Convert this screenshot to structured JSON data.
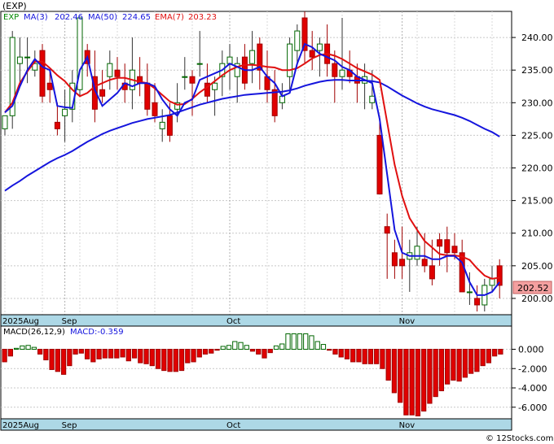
{
  "header": {
    "symbol_label": "(EXP)",
    "legend": {
      "exp": "EXP",
      "ma3_label": "MA(3)",
      "ma3_value": "202.46",
      "ma50_label": "MA(50)",
      "ma50_value": "224.65",
      "ema7_label": "EMA(7)",
      "ema7_value": "203.23"
    }
  },
  "last_price_label": "202.52",
  "macd_legend": {
    "name": "MACD(26,12,9)",
    "value": "MACD:-0.359"
  },
  "month_labels": [
    {
      "text": "2025Aug",
      "index": 0
    },
    {
      "text": "Sep",
      "index": 8
    },
    {
      "text": "Oct",
      "index": 30
    },
    {
      "text": "Nov",
      "index": 53
    }
  ],
  "watermark": "© 12Stocks.com",
  "colors": {
    "up": "#ffffff",
    "down": "#e00000",
    "ma3": "#1515dd",
    "ma50": "#1515dd",
    "ema7": "#e01010",
    "axis_band": "#add8e6",
    "price_tag_bg": "#f4a0a0",
    "macd_pos": "#ffffff",
    "macd_neg": "#e00000"
  },
  "chart_data": {
    "type": "candlestick",
    "price_axis": {
      "ylim": [
        197.5,
        244
      ],
      "ticks": [
        200,
        205,
        210,
        215,
        220,
        225,
        230,
        235,
        240
      ]
    },
    "macd_axis": {
      "ylim": [
        -7.2,
        2.4
      ],
      "ticks": [
        0.0,
        -2.0,
        -4.0,
        -6.0
      ],
      "tick_labels": [
        "0.000",
        "-2.000",
        "-4.000",
        "-6.000"
      ]
    },
    "candles": [
      [
        226,
        228,
        225,
        228
      ],
      [
        228,
        241,
        226,
        240
      ],
      [
        236,
        240,
        233,
        237
      ],
      [
        237,
        240,
        233,
        237
      ],
      [
        235,
        238,
        234,
        236
      ],
      [
        238,
        239,
        230,
        231
      ],
      [
        233,
        235,
        230,
        232
      ],
      [
        227,
        230,
        225,
        226
      ],
      [
        228,
        232,
        224,
        229
      ],
      [
        229,
        235,
        227,
        233
      ],
      [
        232,
        243,
        231,
        243
      ],
      [
        238,
        239,
        234,
        236
      ],
      [
        234,
        238,
        227,
        229
      ],
      [
        232,
        235,
        230,
        231
      ],
      [
        234,
        238,
        232,
        236
      ],
      [
        235,
        237,
        232,
        234
      ],
      [
        233,
        236,
        230,
        232
      ],
      [
        232,
        240,
        229,
        235
      ],
      [
        234,
        237,
        231,
        233
      ],
      [
        233,
        236,
        228,
        229
      ],
      [
        230,
        233,
        227,
        228
      ],
      [
        226,
        229,
        224,
        227
      ],
      [
        228,
        230,
        224,
        225
      ],
      [
        229,
        233,
        227,
        230
      ],
      [
        234,
        237,
        232,
        234
      ],
      [
        234,
        235,
        228,
        233
      ],
      [
        236,
        241,
        234,
        236
      ],
      [
        233,
        236,
        230,
        231
      ],
      [
        232,
        234,
        228,
        233
      ],
      [
        234,
        238,
        231,
        236
      ],
      [
        236,
        239,
        232,
        237
      ],
      [
        234,
        237,
        230,
        236
      ],
      [
        237,
        239,
        232,
        233
      ],
      [
        236,
        241,
        233,
        238
      ],
      [
        239,
        240,
        232,
        235
      ],
      [
        234,
        238,
        230,
        232
      ],
      [
        232,
        235,
        227,
        228
      ],
      [
        230,
        233,
        229,
        231
      ],
      [
        234,
        240,
        232,
        239
      ],
      [
        238,
        242,
        236,
        241
      ],
      [
        243,
        244,
        236,
        238
      ],
      [
        238,
        241,
        235,
        237
      ],
      [
        238,
        240,
        234,
        239
      ],
      [
        239,
        242,
        234,
        236
      ],
      [
        236,
        238,
        230,
        234
      ],
      [
        234,
        243,
        232,
        235
      ],
      [
        235,
        238,
        233,
        234
      ],
      [
        234,
        236,
        230,
        233
      ],
      [
        233,
        236,
        229,
        234
      ],
      [
        230,
        235,
        229,
        231
      ],
      [
        225,
        228,
        216,
        216
      ],
      [
        211,
        213,
        203,
        210
      ],
      [
        207,
        209,
        203,
        205
      ],
      [
        206,
        211,
        203,
        205
      ],
      [
        206,
        209,
        201,
        207
      ],
      [
        206,
        211,
        205,
        208
      ],
      [
        206,
        210,
        204,
        205
      ],
      [
        205,
        209,
        202,
        203
      ],
      [
        209,
        210,
        205,
        208
      ],
      [
        209,
        211,
        204,
        207
      ],
      [
        208,
        210,
        206,
        207
      ],
      [
        207,
        209,
        201,
        201
      ],
      [
        201,
        204,
        199,
        201
      ],
      [
        200,
        202,
        198,
        199
      ],
      [
        199,
        203,
        198,
        202
      ],
      [
        202,
        205,
        201,
        203
      ],
      [
        205,
        206,
        200,
        202
      ]
    ],
    "ma3": [
      228.5,
      229.5,
      232.5,
      235,
      236.7,
      235.5,
      235,
      229.5,
      229.3,
      229.2,
      235,
      237,
      232,
      229.5,
      230.5,
      231.5,
      233,
      232.5,
      233,
      233,
      232.5,
      230.5,
      229,
      228,
      230,
      230.5,
      233.5,
      234,
      234.5,
      235,
      236,
      235.5,
      235,
      235,
      235.5,
      234,
      233,
      231,
      231.5,
      236,
      239,
      238.5,
      237.5,
      237,
      236.5,
      235.5,
      235,
      234,
      233.5,
      233,
      227.5,
      219,
      210.5,
      207,
      206.5,
      206.5,
      206.5,
      206,
      206,
      206.5,
      206.5,
      205.5,
      202.5,
      200.5,
      200.5,
      201,
      202.5
    ],
    "ma50": [
      216.5,
      217.3,
      218,
      218.8,
      219.5,
      220.2,
      220.9,
      221.5,
      222,
      222.6,
      223.3,
      224,
      224.6,
      225.2,
      225.7,
      226.1,
      226.5,
      226.9,
      227.2,
      227.5,
      227.7,
      227.9,
      228.1,
      228.5,
      228.9,
      229.3,
      229.7,
      230,
      230.3,
      230.6,
      230.8,
      231,
      231.2,
      231.3,
      231.4,
      231.5,
      231.6,
      231.7,
      231.9,
      232.2,
      232.6,
      232.9,
      233.2,
      233.4,
      233.5,
      233.5,
      233.4,
      233.4,
      233.4,
      233.3,
      233.1,
      232.5,
      231.8,
      231.1,
      230.5,
      229.9,
      229.4,
      229,
      228.7,
      228.4,
      228.1,
      227.7,
      227.2,
      226.6,
      226,
      225.5,
      224.8
    ],
    "ema7": [
      228.5,
      230,
      233,
      234.8,
      236.3,
      236.3,
      235.3,
      234.2,
      233.3,
      232,
      231,
      231.5,
      232.5,
      233,
      233.5,
      233.8,
      233.8,
      233.5,
      233.2,
      233,
      232.2,
      231.2,
      230.2,
      229.7,
      229.8,
      230.6,
      231.6,
      232.4,
      233.3,
      234.2,
      235,
      235.5,
      235.8,
      235.8,
      235.7,
      235.5,
      235.4,
      235,
      235,
      235.3,
      236,
      236.8,
      237.3,
      237.5,
      237.2,
      236.7,
      236,
      235.3,
      234.8,
      234.3,
      233.5,
      227,
      220.5,
      215.7,
      212.3,
      210.5,
      208.8,
      207.8,
      206.8,
      206.6,
      206.6,
      206.4,
      205.9,
      204.6,
      203.5,
      203,
      203.2
    ],
    "macd_hist": [
      -1.3,
      -0.7,
      0.1,
      0.35,
      0.4,
      0.2,
      -0.5,
      -1.1,
      -2.1,
      -2.3,
      -2.6,
      -1.7,
      -0.5,
      -0.4,
      -1.0,
      -1.3,
      -1.0,
      -0.9,
      -0.9,
      -0.9,
      -0.8,
      -1.2,
      -0.9,
      -1.4,
      -1.5,
      -1.7,
      -2.0,
      -2.2,
      -2.3,
      -2.3,
      -2.2,
      -1.4,
      -1.3,
      -0.8,
      -0.5,
      -0.4,
      -0.1,
      0.3,
      0.4,
      0.8,
      0.7,
      0.4,
      -0.2,
      -0.5,
      -0.9,
      -0.35,
      0.35,
      0.55,
      1.6,
      1.6,
      1.6,
      1.6,
      1.4,
      0.8,
      0.5,
      -0.1,
      -0.5,
      -0.8,
      -1.0,
      -1.3,
      -1.3,
      -1.5,
      -1.5,
      -1.5,
      -2.0,
      -3.2,
      -4.5,
      -5.5,
      -6.8,
      -6.8,
      -6.9,
      -6.4,
      -5.6,
      -4.9,
      -4.3,
      -3.6,
      -3.2,
      -3.3,
      -2.9,
      -2.5,
      -2.3,
      -1.7,
      -1.4,
      -0.7,
      -0.5
    ]
  }
}
